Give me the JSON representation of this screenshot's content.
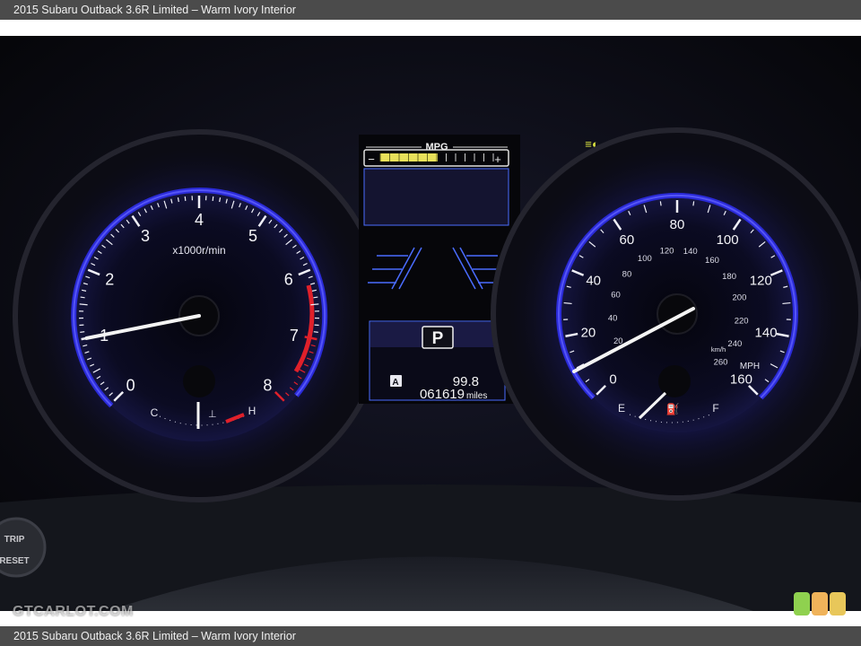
{
  "caption": "2015 Subaru Outback 3.6R Limited – Warm Ivory Interior",
  "watermark": "GTCARLOT.COM",
  "logo": {
    "colors": [
      "#8fd14f",
      "#f0b35a",
      "#e8c75a"
    ]
  },
  "tachometer": {
    "numbers": [
      "0",
      "1",
      "2",
      "3",
      "4",
      "5",
      "6",
      "7",
      "8"
    ],
    "unit": "x1000r/min",
    "temp_cold": "C",
    "temp_hot": "H",
    "needle_reading": 1.0
  },
  "speedometer": {
    "mph_numbers": [
      "0",
      "20",
      "40",
      "60",
      "80",
      "100",
      "120",
      "140",
      "160"
    ],
    "kmh_numbers": [
      "20",
      "40",
      "60",
      "80",
      "100",
      "120",
      "140",
      "160",
      "180",
      "200",
      "220",
      "240",
      "260"
    ],
    "unit_mph": "MPH",
    "unit_kmh": "km/h",
    "fuel_empty": "E",
    "fuel_full": "F"
  },
  "center_display": {
    "mpg_label": "MPG",
    "minus": "−",
    "plus": "+",
    "gear": "P",
    "trip_letter": "A",
    "trip_value": "99.8",
    "odometer": "061619",
    "odometer_unit": "miles"
  },
  "trip_reset_button": {
    "line1": "TRIP",
    "line2": "RESET"
  },
  "colors": {
    "accent_blue": "#3b3bff",
    "redline": "#e0202a",
    "mpg_bar": "#e8e05a"
  }
}
